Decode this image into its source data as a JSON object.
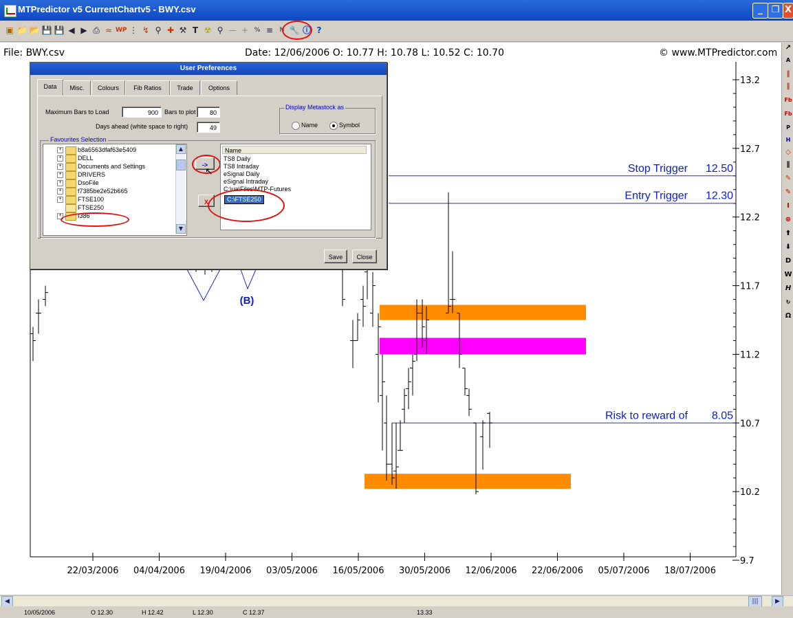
{
  "window": {
    "title": "MTPredictor v5 CurrentChartv5 - BWY.csv",
    "buttons": [
      "_",
      "❐",
      "X"
    ]
  },
  "toolbar": {
    "icons": [
      "open-icon",
      "folder-icon",
      "folder2-icon",
      "save-icon",
      "save2-icon",
      "arrow-left-icon",
      "arrow-right-icon",
      "print-icon",
      "wave-icon",
      "wp-icon",
      "bars-icon",
      "pen-icon",
      "zoom-icon",
      "trend-icon",
      "tool-icon",
      "text-icon",
      "nuclear-icon",
      "zoom2-icon",
      "line-icon",
      "cross-icon",
      "percent-icon",
      "grid-icon",
      "n-icon",
      "preferences-icon",
      "info-icon",
      "help-icon"
    ],
    "labels": {
      "wp": "WP",
      "text": "T",
      "help": "?"
    }
  },
  "chart_header": {
    "file": "File: BWY.csv",
    "ohlc": "Date: 12/06/2006   O: 10.77   H: 10.78   L: 10.52   C: 10.70",
    "site": "© www.MTPredictor.com"
  },
  "chart_data": {
    "type": "ohlc",
    "x_ticks": [
      "22/03/2006",
      "04/04/2006",
      "19/04/2006",
      "03/05/2006",
      "16/05/2006",
      "30/05/2006",
      "12/06/2006",
      "22/06/2006",
      "05/07/2006",
      "18/07/2006"
    ],
    "y_ticks": [
      "13.2",
      "12.7",
      "12.2",
      "11.7",
      "11.2",
      "10.7",
      "10.2",
      "9.7"
    ],
    "ylim": [
      9.7,
      13.2
    ],
    "annotations": [
      {
        "label": "Stop Trigger",
        "value": "12.50",
        "y": 12.5
      },
      {
        "label": "Entry Trigger",
        "value": "12.30",
        "y": 12.3
      },
      {
        "label": "Risk to reward of",
        "value": "8.05",
        "y": 10.7
      }
    ],
    "wave_label": "(B)",
    "zones": [
      {
        "color": "#ff8c00",
        "y_high": 11.56,
        "y_low": 11.45,
        "x_from": "16/05/2006+",
        "x_to": "22/06/2006+"
      },
      {
        "color": "#ff00ff",
        "y_high": 11.32,
        "y_low": 11.2,
        "x_from": "16/05/2006+",
        "x_to": "22/06/2006+"
      },
      {
        "color": "#ff8c00",
        "y_high": 10.33,
        "y_low": 10.22,
        "x_from": "16/05/2006+",
        "x_to": "22/06/2006"
      }
    ],
    "bars": [
      {
        "o": 11.3,
        "h": 11.5,
        "l": 11.3,
        "c": 11.45
      },
      {
        "o": 11.6,
        "h": 11.7,
        "l": 11.4,
        "c": 11.55
      },
      {
        "o": 11.8,
        "h": 12.0,
        "l": 11.6,
        "c": 11.9
      },
      {
        "o": 11.5,
        "h": 11.8,
        "l": 11.4,
        "c": 11.7
      },
      {
        "o": 11.2,
        "h": 11.5,
        "l": 10.85,
        "c": 11.4
      },
      {
        "o": 10.9,
        "h": 11.2,
        "l": 10.5,
        "c": 11.0
      },
      {
        "o": 10.7,
        "h": 10.9,
        "l": 10.28,
        "c": 10.4
      },
      {
        "o": 10.4,
        "h": 10.7,
        "l": 10.25,
        "c": 10.3
      },
      {
        "o": 10.35,
        "h": 10.7,
        "l": 10.22,
        "c": 10.38
      },
      {
        "o": 10.5,
        "h": 10.72,
        "l": 10.5,
        "c": 10.5
      },
      {
        "o": 10.8,
        "h": 10.95,
        "l": 10.7,
        "c": 10.9
      },
      {
        "o": 10.95,
        "h": 11.1,
        "l": 10.8,
        "c": 11.0
      },
      {
        "o": 11.1,
        "h": 11.2,
        "l": 10.9,
        "c": 11.15
      },
      {
        "o": 11.2,
        "h": 11.6,
        "l": 11.15,
        "c": 11.5
      },
      {
        "o": 11.5,
        "h": 11.6,
        "l": 11.25,
        "c": 11.4
      },
      {
        "o": 11.3,
        "h": 11.55,
        "l": 11.2,
        "c": 11.45
      },
      {
        "o": 11.5,
        "h": 12.38,
        "l": 11.5,
        "c": 11.55
      },
      {
        "o": 11.6,
        "h": 11.95,
        "l": 11.5,
        "c": 11.6
      },
      {
        "o": 11.5,
        "h": 11.5,
        "l": 11.1,
        "c": 11.2
      },
      {
        "o": 11.1,
        "h": 11.1,
        "l": 10.9,
        "c": 10.95
      },
      {
        "o": 10.9,
        "h": 10.95,
        "l": 10.75,
        "c": 10.8
      },
      {
        "o": 10.7,
        "h": 10.7,
        "l": 10.18,
        "c": 10.2
      },
      {
        "o": 10.6,
        "h": 10.72,
        "l": 10.36,
        "c": 10.7
      },
      {
        "o": 10.77,
        "h": 10.78,
        "l": 10.52,
        "c": 10.7
      }
    ]
  },
  "dialog": {
    "title": "User Preferences",
    "tabs": [
      "Data",
      "Misc.",
      "Colours",
      "Fib Ratios",
      "Trade",
      "Options"
    ],
    "max_bars_label": "Maximum Bars to Load",
    "max_bars": "900",
    "bars_to_plot_label": "Bars to plot",
    "bars_to_plot": "80",
    "days_ahead_label": "Days ahead (white space to right)",
    "days_ahead": "49",
    "display_group": "Display Metastock as",
    "radio_name": "Name",
    "radio_symbol": "Symbol",
    "favourites_group": "Favourites Selection",
    "tree": [
      "b8a6563dfaf63e5409",
      "DELL",
      "Documents and Settings",
      "DRIVERS",
      "DsoFile",
      "f7385be2e52b665",
      "FTSE100",
      "FTSE250",
      "I386"
    ],
    "list_header": "Name",
    "list_items": [
      "TS8 Daily",
      "TS8 Intraday",
      "eSignal Daily",
      "eSignal Intraday",
      "C:\\ua\\Files\\MTP-Futures",
      "C:\\FTSE250"
    ],
    "add_button": "->",
    "remove_button": "X",
    "save": "Save",
    "close": "Close"
  },
  "status": {
    "date": "10/05/2006",
    "o": "O 12.30",
    "h": "H 12.42",
    "l": "L 12.30",
    "c": "C 12.37",
    "value": "13.33"
  }
}
